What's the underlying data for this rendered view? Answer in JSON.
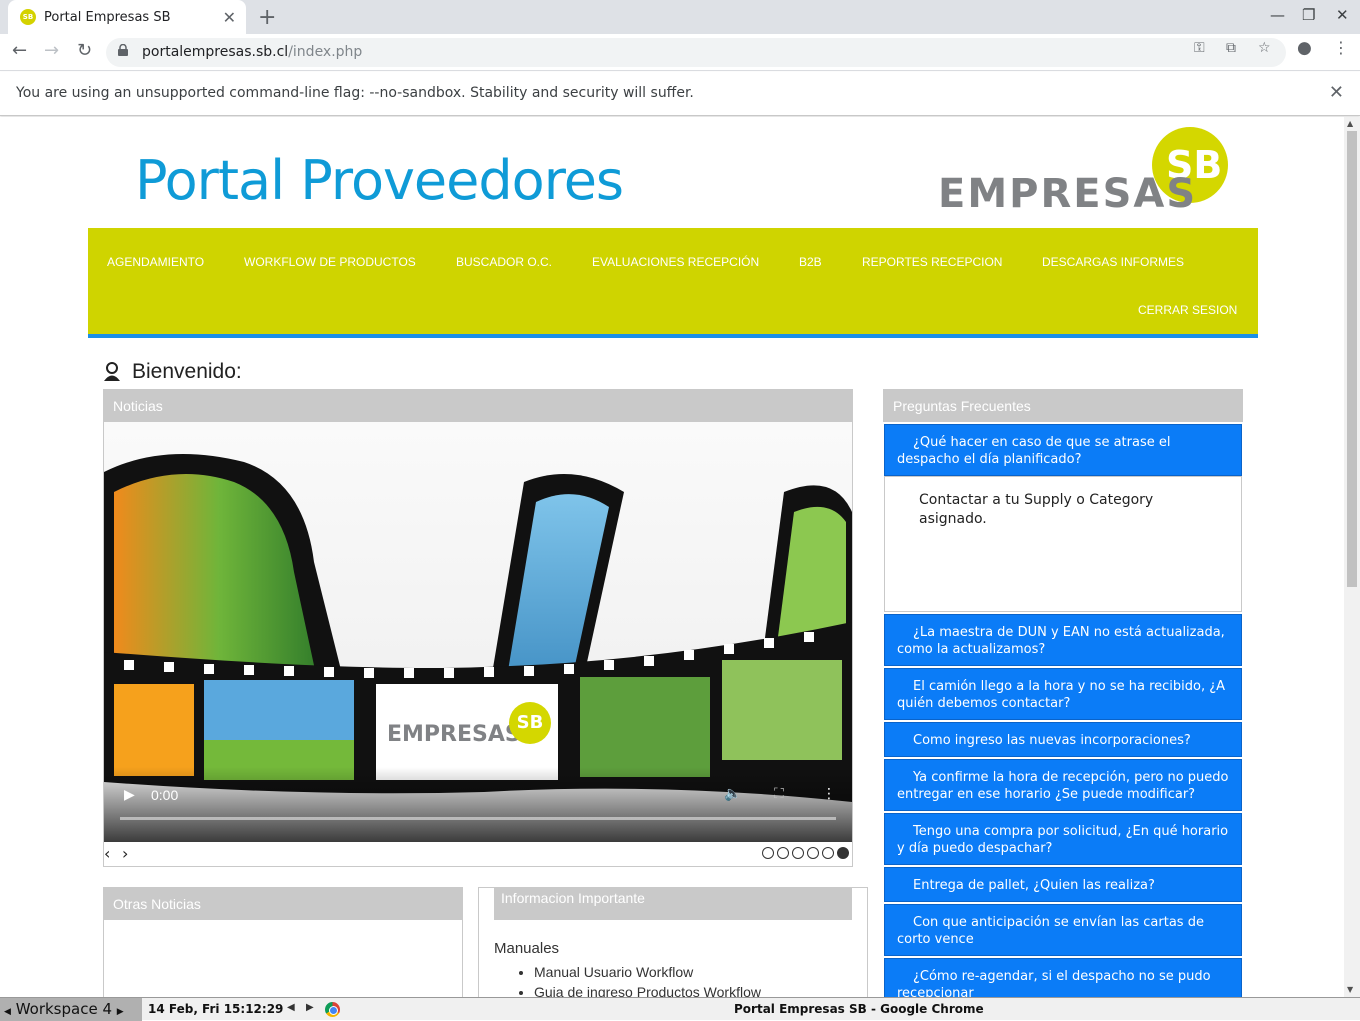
{
  "browser": {
    "tab_title": "Portal Empresas SB",
    "favicon_text": "SB",
    "url_host": "portalempresas.sb.cl",
    "url_path": "/index.php",
    "infobar_message": "You are using an unsupported command-line flag: --no-sandbox. Stability and security will suffer."
  },
  "header": {
    "title": "Portal Proveedores",
    "logo_word": "EMPRESAS",
    "logo_badge": "SB"
  },
  "menu": {
    "items": [
      "AGENDAMIENTO",
      "WORKFLOW DE PRODUCTOS",
      "BUSCADOR O.C.",
      "EVALUACIONES RECEPCIÓN",
      "B2B",
      "REPORTES RECEPCION",
      "DESCARGAS INFORMES",
      "CERRAR SESION"
    ],
    "colors": {
      "background": "#cfd400",
      "underline": "#1b8fe6"
    }
  },
  "welcome": "Bienvenido:",
  "news": {
    "header": "Noticias",
    "video_time": "0:00",
    "video_logo_word": "EMPRESAS",
    "video_logo_badge": "SB",
    "slide_count": 6,
    "active_slide": 6
  },
  "faq": {
    "header": "Preguntas Frecuentes",
    "items": [
      {
        "question": "¿Qué hacer en caso de que se atrase el despacho el día planificado?",
        "expanded": true
      },
      {
        "question": "¿La maestra de DUN y EAN no está actualizada, como la actualizamos?"
      },
      {
        "question": "El camión llego a la hora y no se ha recibido, ¿A quién debemos contactar?"
      },
      {
        "question": "Como ingreso las nuevas incorporaciones?"
      },
      {
        "question": "Ya confirme la hora de recepción, pero no puedo entregar en ese horario ¿Se puede modificar?"
      },
      {
        "question": "Tengo una compra por solicitud, ¿En qué horario y día puedo despachar?"
      },
      {
        "question": "Entrega de pallet, ¿Quien las realiza?"
      },
      {
        "question": "Con que anticipación se envían las cartas de corto vence"
      },
      {
        "question": "¿Cómo re-agendar, si el despacho no se pudo recepcionar"
      }
    ],
    "answer": "Contactar a tu Supply o Category asignado.",
    "accent": "#0b7cf7"
  },
  "otras_noticias": {
    "header": "Otras Noticias"
  },
  "informacion": {
    "header": "Informacion Importante",
    "manuals_title": "Manuales",
    "manuals": [
      "Manual Usuario Workflow",
      "Guia de ingreso Productos Workflow"
    ]
  },
  "taskbar": {
    "workspace": "Workspace 4",
    "clock": "14 Feb, Fri 15:12:29",
    "window_title": "Portal Empresas SB - Google Chrome"
  }
}
